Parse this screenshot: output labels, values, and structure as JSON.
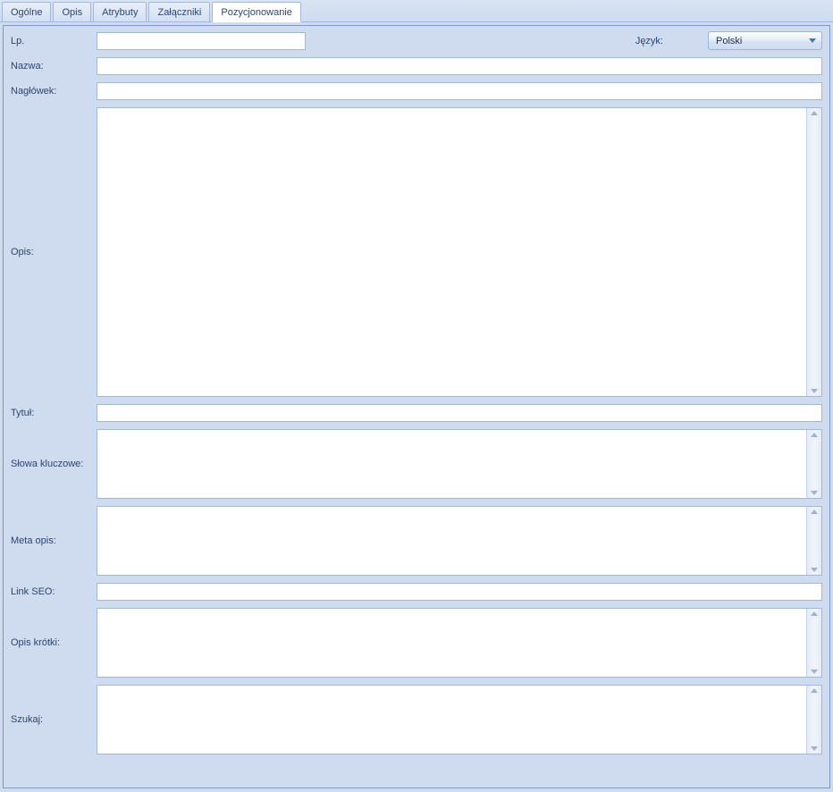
{
  "tabs": [
    {
      "label": "Ogólne"
    },
    {
      "label": "Opis"
    },
    {
      "label": "Atrybuty"
    },
    {
      "label": "Załączniki"
    },
    {
      "label": "Pozycjonowanie"
    }
  ],
  "active_tab_index": 4,
  "form": {
    "lp": {
      "label": "Lp.",
      "value": ""
    },
    "language": {
      "label": "Język:",
      "value": "Polski"
    },
    "nazwa": {
      "label": "Nazwa:",
      "value": ""
    },
    "naglowek": {
      "label": "Nagłówek:",
      "value": ""
    },
    "opis": {
      "label": "Opis:",
      "value": ""
    },
    "tytul": {
      "label": "Tytuł:",
      "value": ""
    },
    "slowa_kluczowe": {
      "label": "Słowa kluczowe:",
      "value": ""
    },
    "meta_opis": {
      "label": "Meta opis:",
      "value": ""
    },
    "link_seo": {
      "label": "Link SEO:",
      "value": ""
    },
    "opis_krotki": {
      "label": "Opis krótki:",
      "value": ""
    },
    "szukaj": {
      "label": "Szukaj:",
      "value": ""
    }
  }
}
